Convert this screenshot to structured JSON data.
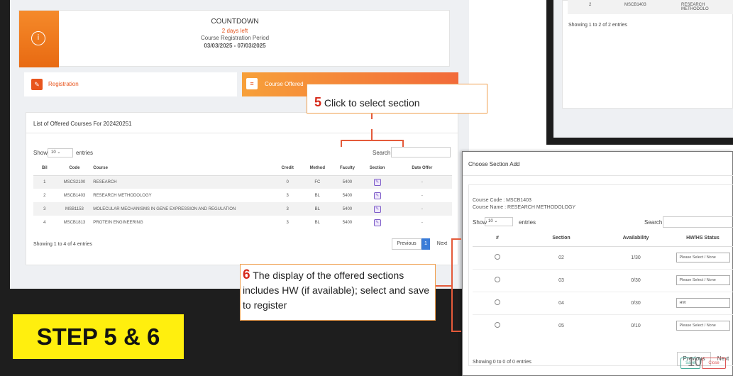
{
  "countdown": {
    "title": "COUNTDOWN",
    "days_left": "2 days left",
    "period_label": "Course Registration Period",
    "dates": "03/03/2025 - 07/03/2025",
    "icon": "info-icon"
  },
  "tabs": {
    "registration": "Registration",
    "course_offered": "Course Offered"
  },
  "course_list": {
    "title": "List of Offered Courses For 202420251",
    "show_label": "Show",
    "show_value": "10",
    "entries_label": "entries",
    "search_label": "Search:",
    "columns": [
      "Bil",
      "Code",
      "Course",
      "Credit",
      "Method",
      "Faculty",
      "Section",
      "Date Offer"
    ],
    "rows": [
      {
        "bil": "1",
        "code": "MSCS2100",
        "course": "RESEARCH",
        "credit": "0",
        "method": "FC",
        "faculty": "5400",
        "date": "-"
      },
      {
        "bil": "2",
        "code": "MSCB1403",
        "course": "RESEARCH METHODOLOGY",
        "credit": "3",
        "method": "BL",
        "faculty": "5400",
        "date": "-"
      },
      {
        "bil": "3",
        "code": "MSB1153",
        "course": "MOLECULAR MECHANISMS IN GENE EXPRESSION AND REGULATION",
        "credit": "3",
        "method": "BL",
        "faculty": "5400",
        "date": "-"
      },
      {
        "bil": "4",
        "code": "MSCB1813",
        "course": "PROTEIN ENGINEERING",
        "credit": "3",
        "method": "BL",
        "faculty": "5400",
        "date": "-"
      }
    ],
    "showing": "Showing 1 to 4 of 4 entries",
    "previous": "Previous",
    "page": "1",
    "next": "Next"
  },
  "callout5": {
    "num": "5",
    "text": " Click to select section"
  },
  "callout6": {
    "num": "6",
    "text": "  The display of the offered sections includes HW (if available); select and save to register"
  },
  "step_label": "STEP 5 & 6",
  "top_right": {
    "row_bil": "2",
    "row_code": "MSCB1403",
    "row_course": "RESEARCH METHODOLO",
    "showing": "Showing 1 to 2 of 2 entries"
  },
  "modal": {
    "title": "Choose Section Add",
    "course_code": "Course Code : MSCB1403",
    "course_name": "Course Name : RESEARCH METHODOLOGY",
    "show_label": "Show",
    "show_value": "10",
    "entries_label": "entries",
    "search_label": "Search:",
    "columns": [
      "#",
      "Section",
      "Availability",
      "HW/HS Status"
    ],
    "rows": [
      {
        "section": "02",
        "availability": "1/30",
        "status": "Please Select / None"
      },
      {
        "section": "03",
        "availability": "0/30",
        "status": "Please Select / None"
      },
      {
        "section": "04",
        "availability": "0/30",
        "status": "HW"
      },
      {
        "section": "05",
        "availability": "0/10",
        "status": "Please Select / None"
      }
    ],
    "showing": "Showing 0 to 0 of 0 entries",
    "previous": "Previous",
    "next": "Next",
    "save": "Save",
    "close": "Close"
  },
  "page_number": "10",
  "colors": {
    "accent": "#e8541c",
    "callout_border": "#f0a050",
    "step_bg": "#ffef0e"
  }
}
